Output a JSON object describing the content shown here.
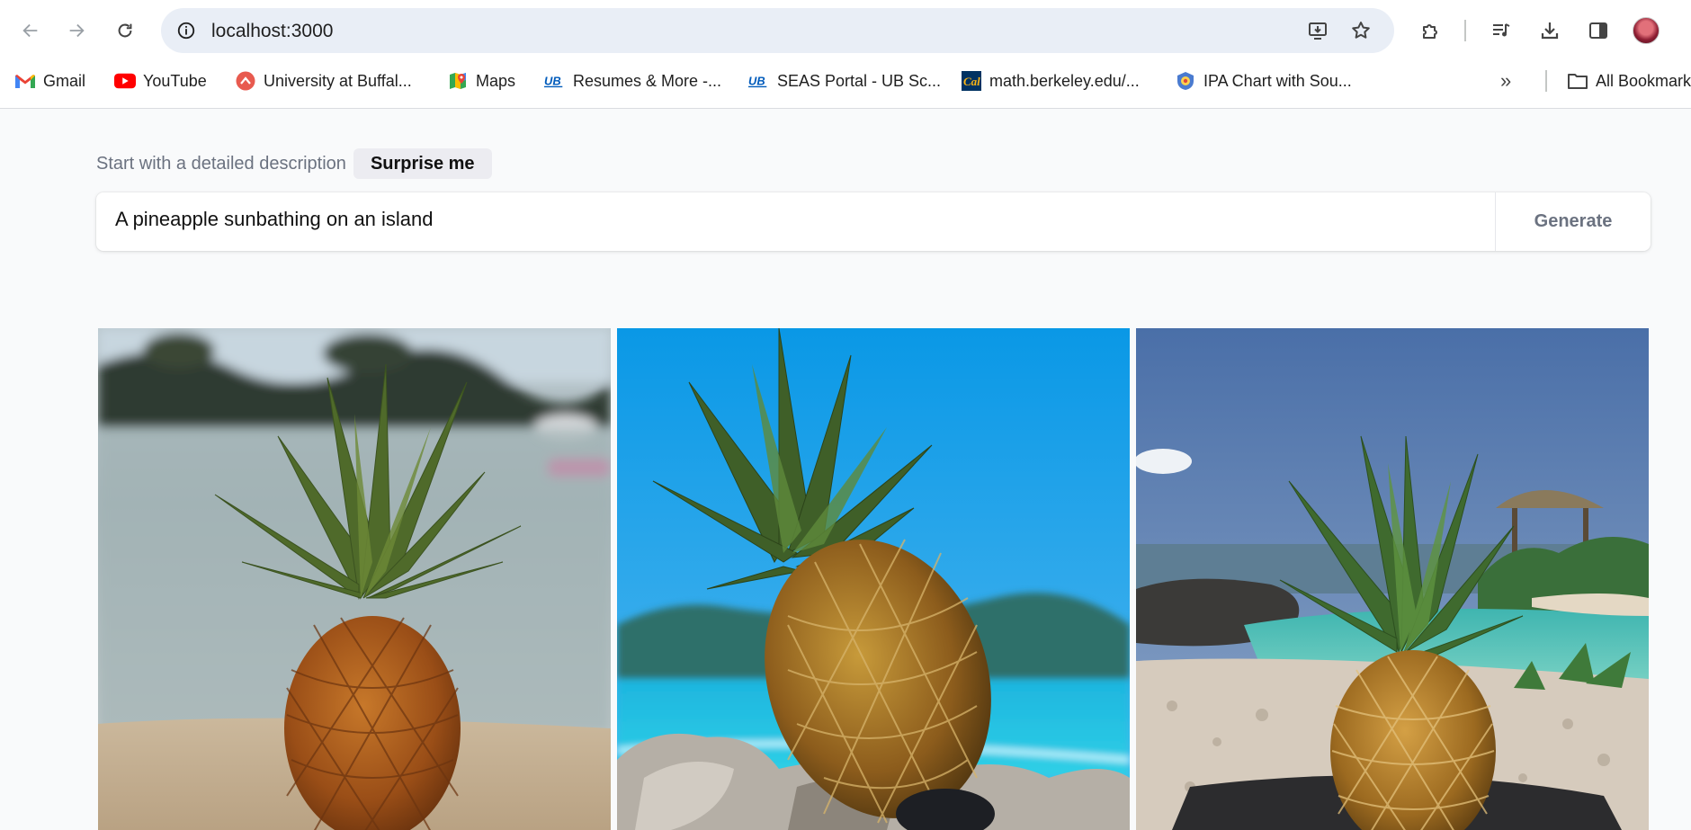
{
  "browser": {
    "url": "localhost:3000",
    "bookmarks": [
      {
        "label": "Gmail",
        "icon": "gmail-icon"
      },
      {
        "label": "YouTube",
        "icon": "youtube-icon"
      },
      {
        "label": "University at Buffal...",
        "icon": "ub-app-icon"
      },
      {
        "label": "Maps",
        "icon": "maps-icon"
      },
      {
        "label": "Resumes & More -...",
        "icon": "ub-logo-icon"
      },
      {
        "label": "SEAS Portal - UB Sc...",
        "icon": "ub-logo-icon"
      },
      {
        "label": "math.berkeley.edu/...",
        "icon": "cal-icon"
      },
      {
        "label": "IPA Chart with Sou...",
        "icon": "ipa-icon"
      }
    ],
    "all_bookmarks_label": "All Bookmarks"
  },
  "prompt": {
    "hint": "Start with a detailed description",
    "surprise_label": "Surprise me",
    "value": "A pineapple sunbathing on an island",
    "generate_label": "Generate"
  },
  "gallery": {
    "images": [
      {
        "subject": "pineapple on sandy beach with blurred lagoon"
      },
      {
        "subject": "pineapple on rocks with turquoise sea and mountains"
      },
      {
        "subject": "pineapple on rocky shore with pool and thatched hut"
      }
    ]
  },
  "colors": {
    "toolbar_bg": "#ffffff",
    "omnibox_bg": "#e9eef6",
    "page_bg": "#f9fafb",
    "muted_text": "#6b7280"
  }
}
